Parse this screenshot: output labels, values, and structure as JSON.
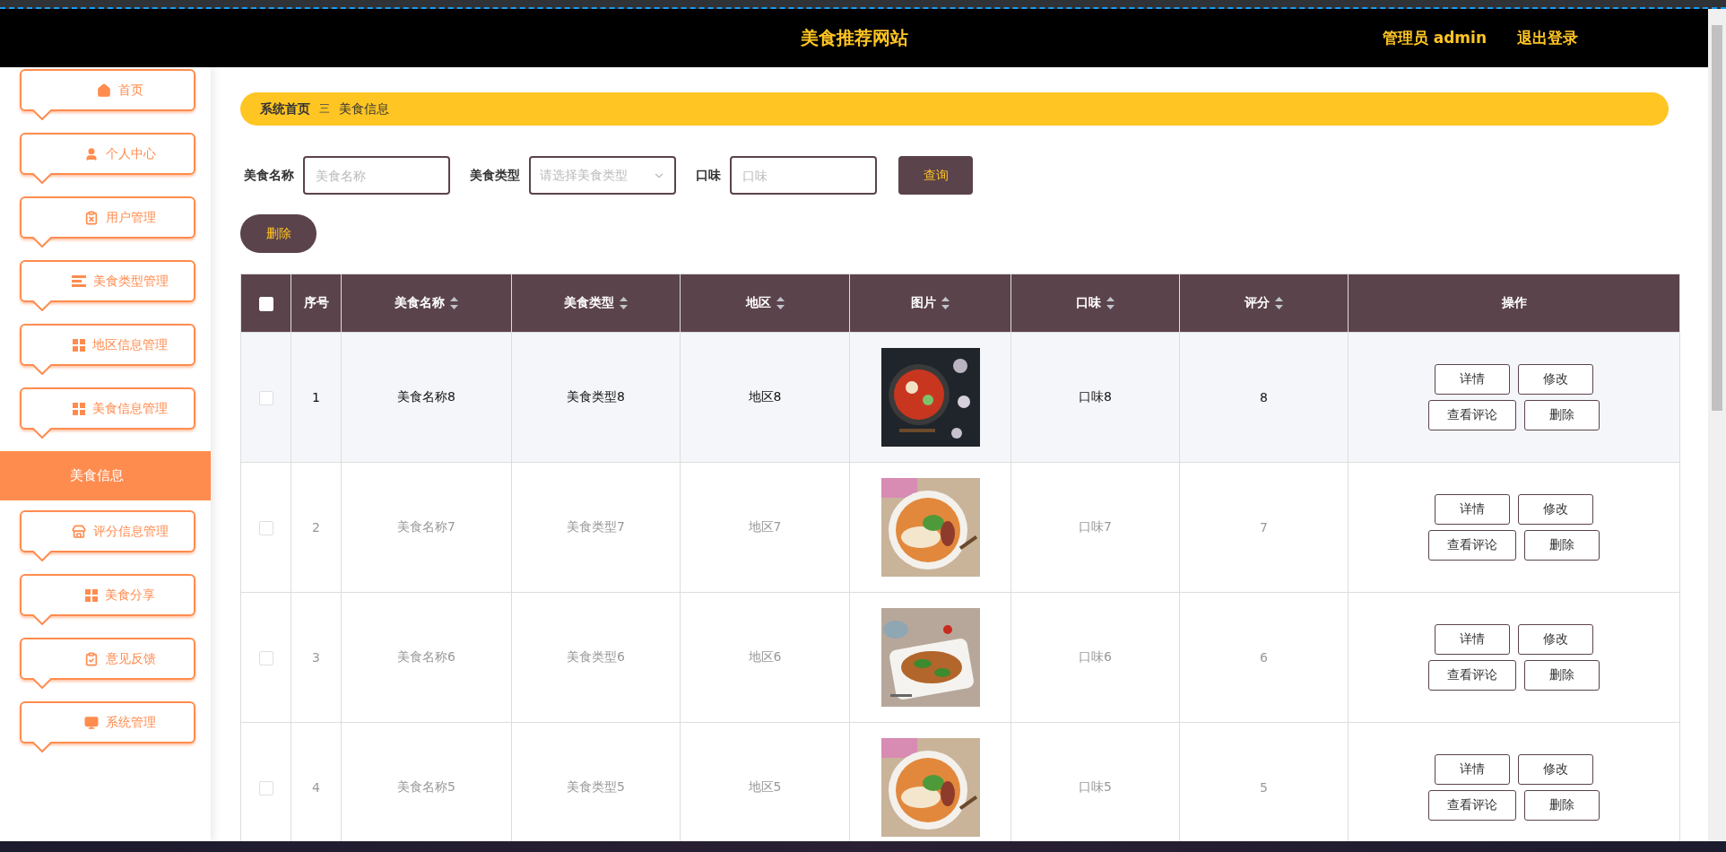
{
  "header": {
    "title": "美食推荐网站",
    "user": "管理员 admin",
    "logout": "退出登录"
  },
  "sidebar": {
    "items": [
      {
        "label": "首页",
        "selected": false
      },
      {
        "label": "个人中心",
        "selected": false
      },
      {
        "label": "用户管理",
        "selected": false
      },
      {
        "label": "美食类型管理",
        "selected": false
      },
      {
        "label": "地区信息管理",
        "selected": false
      },
      {
        "label": "美食信息管理",
        "selected": false,
        "expanded": true,
        "children": [
          {
            "label": "美食信息",
            "selected": true
          }
        ]
      },
      {
        "label": "评分信息管理",
        "selected": false
      },
      {
        "label": "美食分享",
        "selected": false
      },
      {
        "label": "意见反馈",
        "selected": false
      },
      {
        "label": "系统管理",
        "selected": false
      }
    ]
  },
  "breadcrumb": {
    "items": [
      "系统首页",
      "美食信息"
    ],
    "separator": "三"
  },
  "filters": [
    {
      "label": "美食名称",
      "kind": "text",
      "placeholder": "美食名称"
    },
    {
      "label": "美食类型",
      "kind": "select",
      "placeholder": "请选择美食类型"
    },
    {
      "label": "口味",
      "kind": "text",
      "placeholder": "口味"
    }
  ],
  "search_button": "查询",
  "delete_button": "删除",
  "table": {
    "select_all": {
      "checked": false
    },
    "columns": [
      {
        "label": "序号",
        "sortable": false
      },
      {
        "label": "美食名称",
        "sortable": true
      },
      {
        "label": "美食类型",
        "sortable": true
      },
      {
        "label": "地区",
        "sortable": true
      },
      {
        "label": "图片",
        "sortable": true
      },
      {
        "label": "口味",
        "sortable": true
      },
      {
        "label": "评分",
        "sortable": true
      },
      {
        "label": "操作",
        "sortable": false
      }
    ],
    "rows": [
      {
        "checked": false,
        "highlighted": true,
        "index": "1",
        "name": "美食名称8",
        "type": "美食类型8",
        "region": "地区8",
        "taste": "口味8",
        "score": "8",
        "actions": [
          "详情",
          "修改",
          "查看评论",
          "删除"
        ]
      },
      {
        "checked": false,
        "highlighted": false,
        "index": "2",
        "name": "美食名称7",
        "type": "美食类型7",
        "region": "地区7",
        "taste": "口味7",
        "score": "7",
        "actions": [
          "详情",
          "修改",
          "查看评论",
          "删除"
        ]
      },
      {
        "checked": false,
        "highlighted": false,
        "index": "3",
        "name": "美食名称6",
        "type": "美食类型6",
        "region": "地区6",
        "taste": "口味6",
        "score": "6",
        "actions": [
          "详情",
          "修改",
          "查看评论",
          "删除"
        ]
      },
      {
        "checked": false,
        "highlighted": false,
        "index": "4",
        "name": "美食名称5",
        "type": "美食类型5",
        "region": "地区5",
        "taste": "口味5",
        "score": "5",
        "actions": [
          "详情",
          "修改",
          "查看评论",
          "删除"
        ]
      }
    ]
  }
}
